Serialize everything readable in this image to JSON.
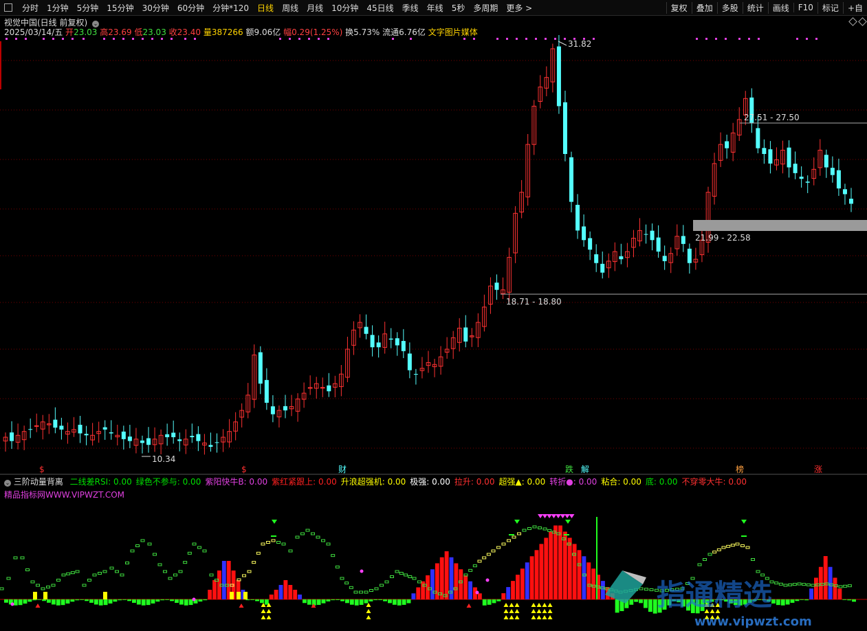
{
  "toolbar": {
    "tabs": [
      "分时",
      "1分钟",
      "5分钟",
      "15分钟",
      "30分钟",
      "60分钟",
      "分钟*120",
      "日线",
      "周线",
      "月线",
      "10分钟",
      "45日线",
      "季线",
      "年线",
      "5秒",
      "多周期",
      "更多 >"
    ],
    "active_tab": "日线",
    "right": [
      "复权",
      "叠加",
      "多股",
      "统计",
      "画线",
      "F10",
      "标记",
      "+自"
    ]
  },
  "stock": {
    "title": "视觉中国(日线 前复权)",
    "date": "2025/03/14/五",
    "open_l": "开",
    "open": "23.03",
    "high_l": "高",
    "high": "23.69",
    "low_l": "低",
    "low": "23.03",
    "close_l": "收",
    "close": "23.40",
    "vol_l": "量",
    "vol": "387266",
    "amt_l": "额",
    "amt": "9.06亿",
    "chg_l": "幅",
    "chg": "0.29(1.25%)",
    "turn_l": "换",
    "turn": "5.73%",
    "float_l": "流通",
    "float": "6.76亿",
    "concept": "文字图片媒体"
  },
  "annotations": {
    "peak": "31.82",
    "low": "10.34",
    "zone1": "27.51 - 27.50",
    "zone2": "21.99 - 22.58",
    "zone3": "18.71 - 18.80"
  },
  "event_markers": [
    "$",
    "$",
    "财",
    "跌",
    "解",
    "榜",
    "涨"
  ],
  "indicator": {
    "name": "三阶动量背离",
    "params": [
      {
        "label": "二线差RSI: 0.00",
        "color": "#00e000"
      },
      {
        "label": "绿色不参与: 0.00",
        "color": "#00e000"
      },
      {
        "label": "紫阳快牛B: 0.00",
        "color": "#e040e0"
      },
      {
        "label": "紫红紧跟上: 0.00",
        "color": "#ff2020"
      },
      {
        "label": "升浪超强机: 0.00",
        "color": "#ffff00"
      },
      {
        "label": "极强: 0.00",
        "color": "#ffffff"
      },
      {
        "label": "拉升: 0.00",
        "color": "#ff3030"
      },
      {
        "label": "超强▲: 0.00",
        "color": "#ffff00"
      },
      {
        "label": "转折●: 0.00",
        "color": "#e040e0"
      },
      {
        "label": "粘合: 0.00",
        "color": "#ffff00"
      },
      {
        "label": "底: 0.00",
        "color": "#00e000"
      },
      {
        "label": "不穿零大牛: 0.00",
        "color": "#ff3030"
      }
    ],
    "site": "精品指标网WWW.VIPWZT.COM"
  },
  "watermark": {
    "brand": "指通精选",
    "url": "www.vipwzt.com"
  },
  "colors": {
    "up": "#ff3232",
    "down": "#54ffff",
    "active": "#ffd400",
    "grid": "#7a0000"
  }
}
